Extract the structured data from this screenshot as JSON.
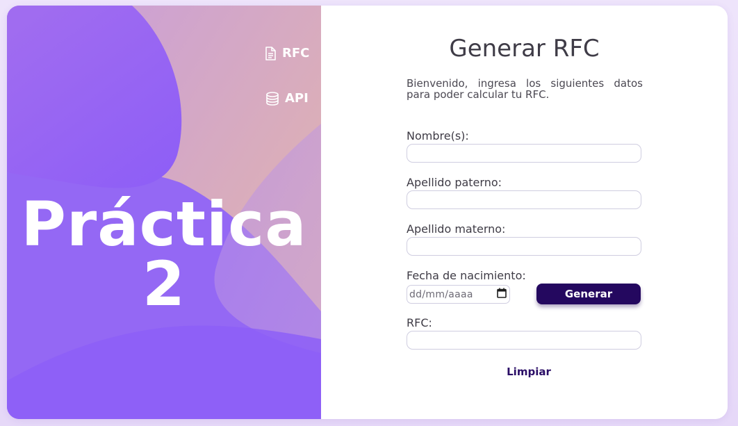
{
  "sidebar": {
    "nav": [
      {
        "label": "RFC",
        "icon": "document-icon"
      },
      {
        "label": "API",
        "icon": "database-icon"
      }
    ],
    "hero_line1": "Práctica",
    "hero_line2": "2"
  },
  "form": {
    "title": "Generar RFC",
    "intro": "Bienvenido, ingresa los siguientes datos para poder calcular tu RFC.",
    "fields": {
      "nombre_label": "Nombre(s):",
      "paterno_label": "Apellido paterno:",
      "materno_label": "Apellido materno:",
      "fecha_label": "Fecha de nacimiento:",
      "fecha_placeholder": "dd/mm/aaaa",
      "rfc_label": "RFC:"
    },
    "generate_label": "Generar",
    "clear_label": "Limpiar"
  },
  "colors": {
    "accent": "#24085f",
    "panel": "#9265f5"
  }
}
